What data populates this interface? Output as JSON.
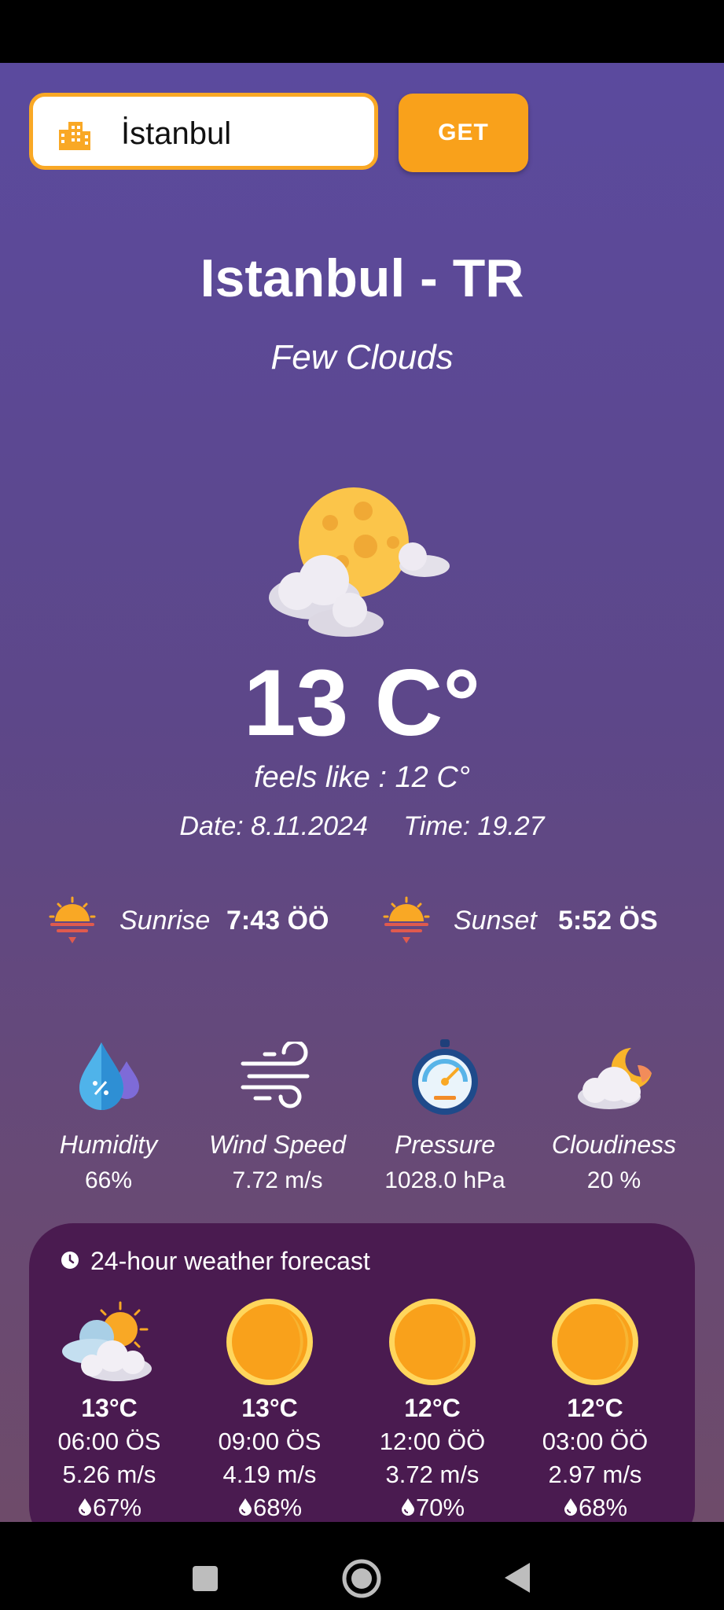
{
  "search": {
    "value": "İstanbul",
    "button_label": "GET"
  },
  "location": {
    "title": "Istanbul - TR",
    "condition": "Few Clouds"
  },
  "current": {
    "temperature": "13 C°",
    "feels_like": "feels like : 12 C°",
    "date": "Date: 8.11.2024",
    "time": "Time: 19.27"
  },
  "sun": {
    "sunrise_label": "Sunrise",
    "sunrise_value": "7:43 ÖÖ",
    "sunset_label": "Sunset",
    "sunset_value": "5:52 ÖS"
  },
  "stats": [
    {
      "label": "Humidity",
      "value": "66%",
      "icon": "humidity-icon"
    },
    {
      "label": "Wind Speed",
      "value": "7.72 m/s",
      "icon": "wind-icon"
    },
    {
      "label": "Pressure",
      "value": "1028.0 hPa",
      "icon": "pressure-gauge-icon"
    },
    {
      "label": "Cloudiness",
      "value": "20 %",
      "icon": "cloud-moon-icon"
    }
  ],
  "forecast": {
    "title": "24-hour weather forecast",
    "items": [
      {
        "temp": "13°C",
        "time": "06:00 ÖS",
        "wind": "5.26 m/s",
        "humidity": "67%",
        "icon": "partly-cloudy-icon"
      },
      {
        "temp": "13°C",
        "time": "09:00 ÖS",
        "wind": "4.19 m/s",
        "humidity": "68%",
        "icon": "sun-icon"
      },
      {
        "temp": "12°C",
        "time": "12:00 ÖÖ",
        "wind": "3.72 m/s",
        "humidity": "70%",
        "icon": "sun-icon"
      },
      {
        "temp": "12°C",
        "time": "03:00 ÖÖ",
        "wind": "2.97 m/s",
        "humidity": "68%",
        "icon": "sun-icon"
      }
    ]
  },
  "colors": {
    "accent": "#f9a11b",
    "card": "#4a1b50",
    "background_top": "#5b4a9e",
    "background_bottom": "#6e4b6a"
  }
}
